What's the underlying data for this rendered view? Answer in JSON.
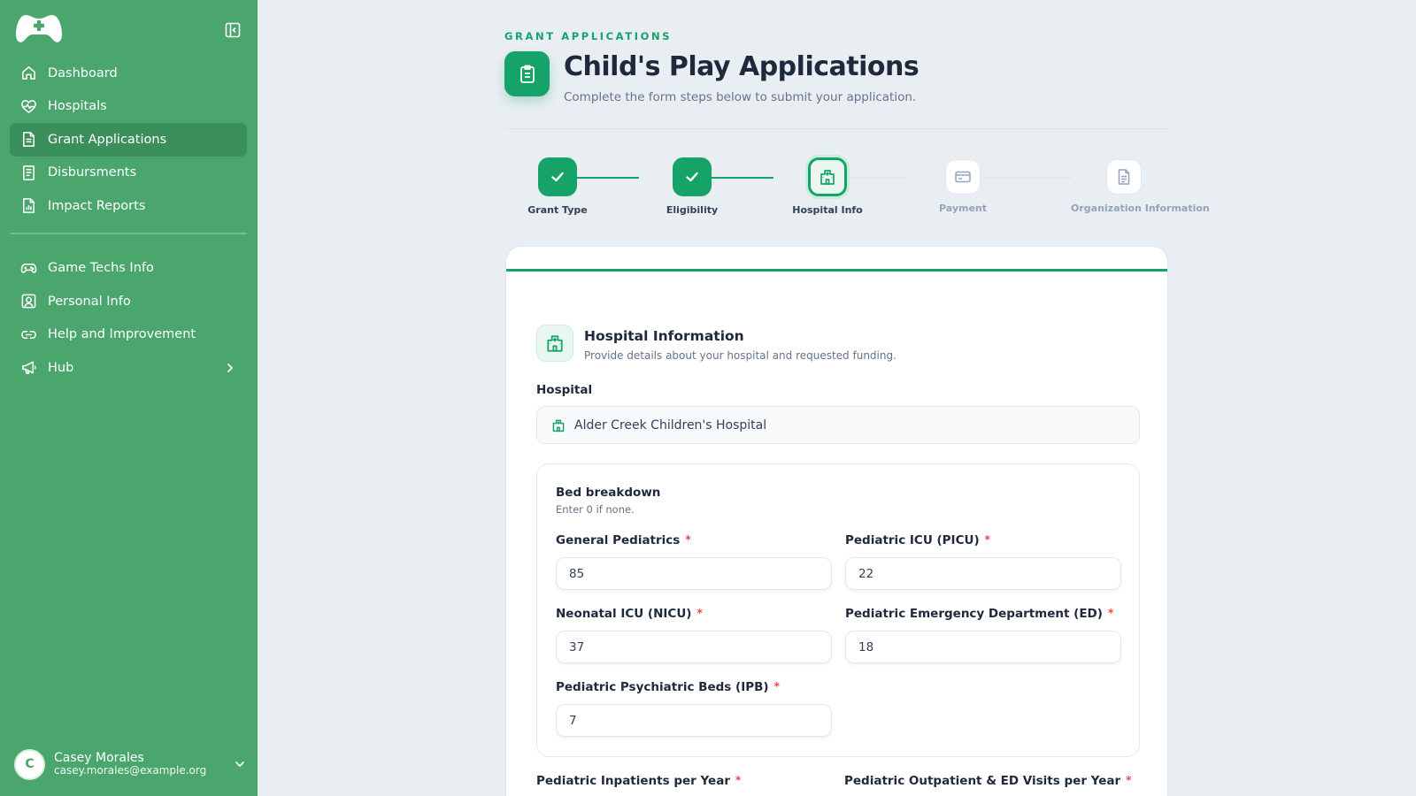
{
  "sidebar": {
    "items": [
      {
        "label": "Dashboard",
        "icon": "home-icon"
      },
      {
        "label": "Hospitals",
        "icon": "heart-pulse-icon"
      },
      {
        "label": "Grant Applications",
        "icon": "document-icon",
        "active": true
      },
      {
        "label": "Disbursments",
        "icon": "receipt-icon"
      },
      {
        "label": "Impact Reports",
        "icon": "chart-file-icon"
      },
      {
        "label": "Game Techs Info",
        "icon": "gamepad-icon"
      },
      {
        "label": "Personal Info",
        "icon": "user-square-icon"
      },
      {
        "label": "Help and Improvement",
        "icon": "link-icon"
      },
      {
        "label": "Hub",
        "icon": "megaphone-icon"
      }
    ],
    "user": {
      "initial": "C",
      "name": "Casey Morales",
      "email": "casey.morales@example.org"
    }
  },
  "header": {
    "eyebrow": "GRANT APPLICATIONS",
    "title": "Child's Play Applications",
    "subtitle": "Complete the form steps below to submit your application."
  },
  "steps": [
    {
      "label": "Grant Type",
      "status": "done"
    },
    {
      "label": "Eligibility",
      "status": "done"
    },
    {
      "label": "Hospital Info",
      "status": "current"
    },
    {
      "label": "Payment",
      "status": "todo"
    },
    {
      "label": "Organization Information",
      "status": "todo"
    }
  ],
  "section": {
    "title": "Hospital Information",
    "subtitle": "Provide details about your hospital and requested funding.",
    "hospital_label": "Hospital",
    "hospital_value": "Alder Creek Children's Hospital"
  },
  "beds": {
    "title": "Bed breakdown",
    "subtitle": "Enter 0 if none.",
    "fields": [
      {
        "label": "General Pediatrics",
        "value": "85"
      },
      {
        "label": "Pediatric ICU (PICU)",
        "value": "22"
      },
      {
        "label": "Neonatal ICU (NICU)",
        "value": "37"
      },
      {
        "label": "Pediatric Emergency Department (ED)",
        "value": "18"
      },
      {
        "label": "Pediatric Psychiatric Beds (IPB)",
        "value": "7"
      }
    ]
  },
  "more_fields": [
    {
      "label": "Pediatric Inpatients per Year"
    },
    {
      "label": "Pediatric Outpatient & ED Visits per Year"
    }
  ],
  "required_mark": "*",
  "colors": {
    "sidebar": "#4aa66c",
    "accent": "#16a36a",
    "background": "#e9eef3",
    "required": "#ef4444"
  }
}
